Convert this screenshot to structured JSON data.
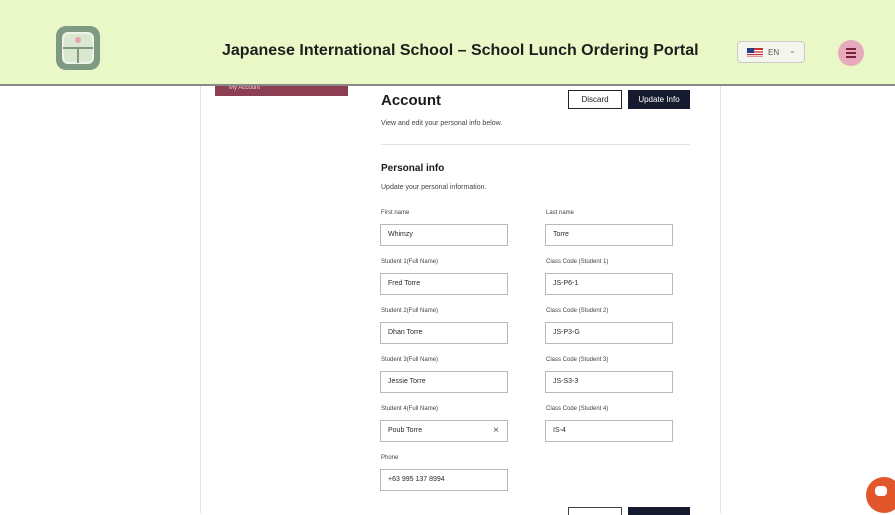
{
  "header": {
    "title": "Japanese International School – School Lunch Ordering Portal",
    "language": "EN",
    "colors": {
      "background": "#eaf7c6",
      "logo": "#7e9a83",
      "menu_button": "#e7aabd"
    }
  },
  "nav": {
    "active_item": "My Account"
  },
  "account": {
    "heading": "Account",
    "subtitle": "View and edit your personal info below.",
    "discard_label": "Discard",
    "update_label": "Update Info"
  },
  "personal": {
    "heading": "Personal info",
    "subtitle": "Update your personal information."
  },
  "fields": {
    "first_name": {
      "label": "First name",
      "value": "Whimzy"
    },
    "last_name": {
      "label": "Last name",
      "value": "Torre"
    },
    "student1": {
      "label": "Student 1(Full Name)",
      "value": "Fred Torre"
    },
    "class1": {
      "label": "Class Code (Student 1)",
      "value": "JS-P6-1"
    },
    "student2": {
      "label": "Student 2(Full Name)",
      "value": "Dhan Torre"
    },
    "class2": {
      "label": "Class Code (Student 2)",
      "value": "JS-P3-G"
    },
    "student3": {
      "label": "Student 3(Full Name)",
      "value": "Jessie Torre"
    },
    "class3": {
      "label": "Class Code (Student 3)",
      "value": "JS-S3-3"
    },
    "student4": {
      "label": "Student 4(Full Name)",
      "value": "Poub Torre"
    },
    "class4": {
      "label": "Class Code (Student 4)",
      "value": "IS-4"
    },
    "phone": {
      "label": "Phone",
      "value": "+63 995 137 8994"
    }
  },
  "icons": {
    "clear": "×",
    "chevron": "⌄"
  }
}
